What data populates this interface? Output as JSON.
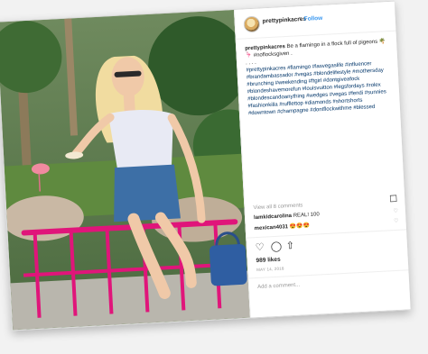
{
  "post": {
    "username": "prettypinkacres",
    "separator": "•",
    "follow_label": "Follow",
    "caption_user": "prettypinkacres",
    "caption_text": "Be a flamingo in a flock full of pigeons 🌴🦩 #noflocksgiven .",
    "caption_dots": ". . . .",
    "hashtags": "#prettypinkacres #flamingo #lasvegaslife #influencer #brandambassador #vegas #blondelifestyle #mothersday #brunching #weekending #ftgirl #dontgiveafock #blondeshavemorefun #louisvuitton #legsfordays #rolex #blondescandoanything #wedges #vegas #fendi #sunnies #fashionkilla #rufflettop #diamonds #shortshorts #downtown #champagne #dontflockwithme #blessed",
    "view_all": "View all 8 comments",
    "comments": [
      {
        "user": "lamkidcarolina",
        "text": "REAL! 100"
      },
      {
        "user": "mexican4031",
        "text": "😍😍😍"
      }
    ],
    "likes": "989 likes",
    "date": "MAY 14, 2018",
    "add_comment": "Add a comment..."
  },
  "icons": {
    "like": "heart-icon",
    "comment": "comment-icon",
    "share": "share-icon",
    "save": "bookmark-icon"
  },
  "colors": {
    "link_blue": "#3897f0",
    "hashtag": "#003569"
  }
}
